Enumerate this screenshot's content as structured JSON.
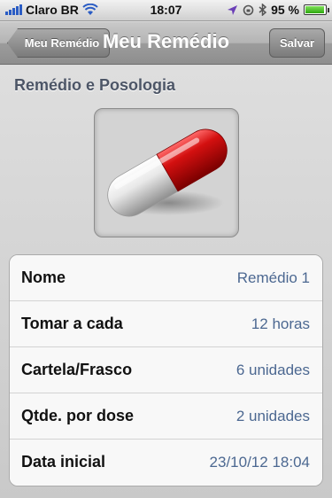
{
  "status_bar": {
    "carrier": "Claro BR",
    "time": "18:07",
    "battery_percent": "95 %",
    "battery_level": 0.95,
    "icons": [
      "signal-icon",
      "wifi-icon",
      "location-icon",
      "lock-rotation-icon",
      "bluetooth-icon",
      "battery-icon"
    ]
  },
  "nav": {
    "back_label": "Meu Remédio",
    "title": "Meu Remédio",
    "save_label": "Salvar"
  },
  "section": {
    "header": "Remédio e Posologia"
  },
  "pill": {
    "icon": "pill-capsule-icon",
    "colors": {
      "red": "#cc1010",
      "white": "#e6e6e6"
    }
  },
  "details": [
    {
      "label": "Nome",
      "value": "Remédio 1"
    },
    {
      "label": "Tomar a cada",
      "value": "12 horas"
    },
    {
      "label": "Cartela/Frasco",
      "value": "6 unidades"
    },
    {
      "label": "Qtde. por dose",
      "value": "2 unidades"
    },
    {
      "label": "Data inicial",
      "value": "23/10/12 18:04"
    }
  ],
  "colors": {
    "value_text": "#4c6891",
    "section_header": "#4c5566"
  }
}
